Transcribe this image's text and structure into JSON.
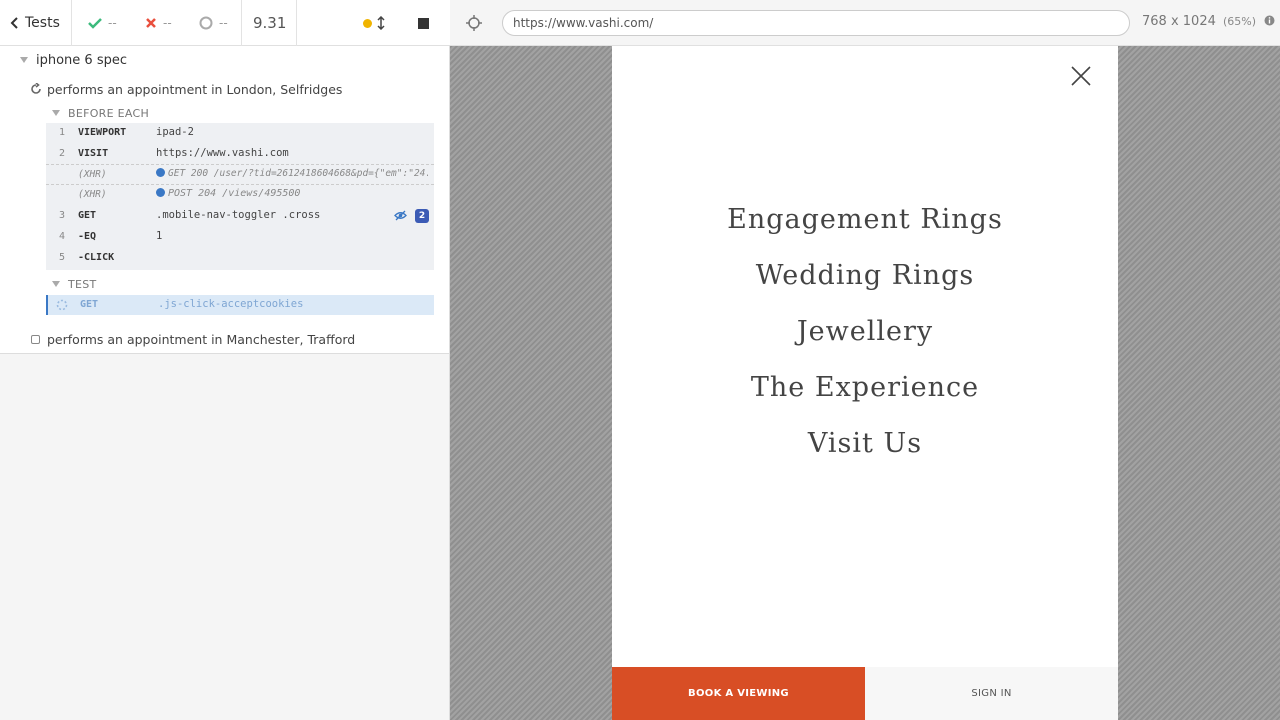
{
  "reporter": {
    "stats": {
      "back_label": "Tests",
      "passed": "--",
      "failed": "--",
      "pending": "--",
      "duration": "9.31"
    },
    "spec_title": "iphone 6 spec",
    "tests": [
      {
        "title": "performs an appointment in London, Selfridges"
      },
      {
        "title": "performs an appointment in Manchester, Trafford"
      }
    ],
    "before_each": {
      "title": "BEFORE EACH",
      "commands": [
        {
          "num": "1",
          "name": "VIEWPORT",
          "message": "ipad-2"
        },
        {
          "num": "2",
          "name": "VISIT",
          "message": "https://www.vashi.com"
        },
        {
          "num": "",
          "name": "(XHR)",
          "message": "GET 200 /user/?tid=2612418604668&pd={\"em\":\"24..."
        },
        {
          "num": "",
          "name": "(XHR)",
          "message": "POST 204 /views/495500"
        },
        {
          "num": "3",
          "name": "GET",
          "message": ".mobile-nav-toggler .cross",
          "count": "2"
        },
        {
          "num": "4",
          "name": "-EQ",
          "message": "1"
        },
        {
          "num": "5",
          "name": "-CLICK",
          "message": ""
        }
      ]
    },
    "test_hook": {
      "title": "TEST",
      "commands": [
        {
          "name": "GET",
          "message": ".js-click-acceptcookies"
        }
      ]
    }
  },
  "aut": {
    "url": "https://www.vashi.com/",
    "viewport": "768 x 1024",
    "scale": "(65%)",
    "menu": [
      "Engagement Rings",
      "Wedding Rings",
      "Jewellery",
      "The Experience",
      "Visit Us"
    ],
    "book_label": "BOOK A VIEWING",
    "signin_label": "SIGN IN"
  },
  "colors": {
    "pass": "#3cba7c",
    "fail": "#e94f3d",
    "running": "#f0b400",
    "accent": "#d84e25",
    "link": "#3a78c5"
  }
}
